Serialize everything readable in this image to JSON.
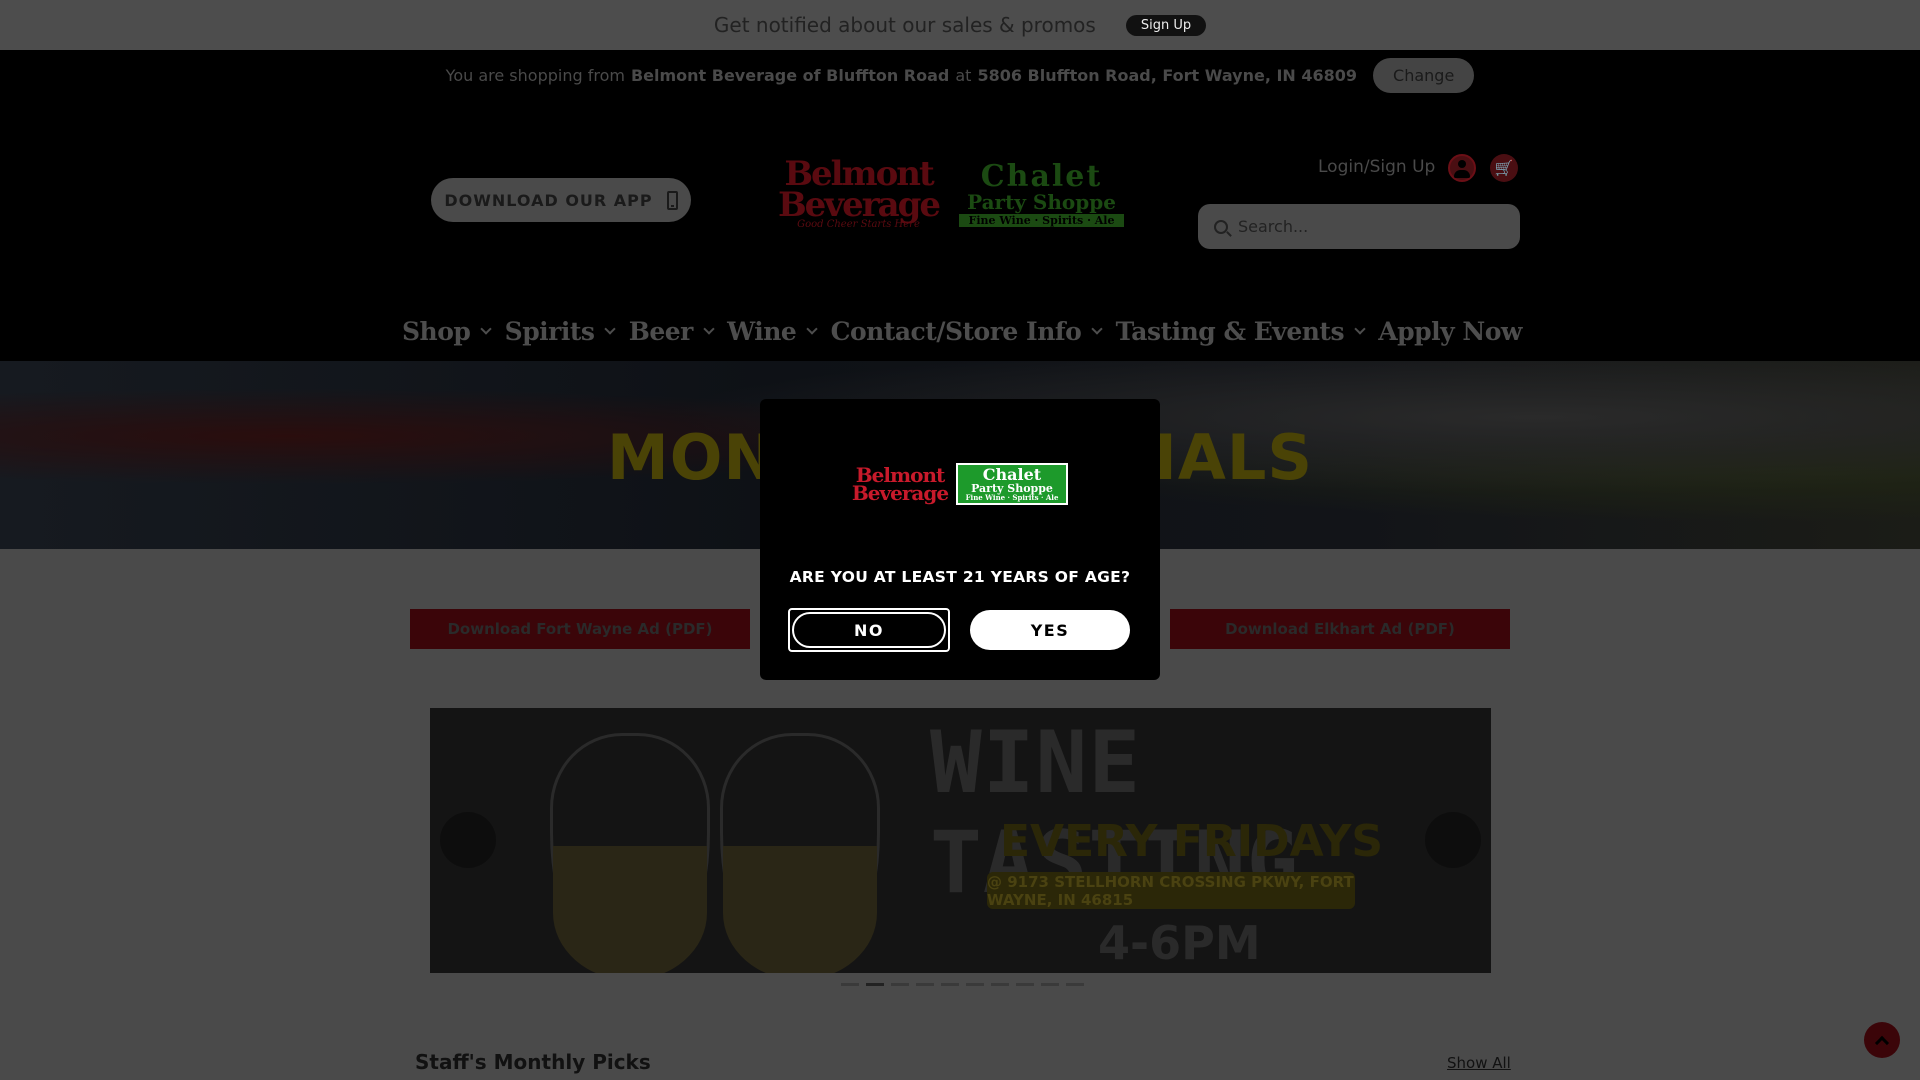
{
  "promo": {
    "text": "Get notified about our sales & promos",
    "button": "Sign Up"
  },
  "store": {
    "prefix": "You are shopping from",
    "name": "Belmont Beverage of Bluffton Road",
    "at": "at",
    "address": "5806 Bluffton Road, Fort Wayne, IN 46809",
    "change": "Change"
  },
  "header": {
    "app_button": "DOWNLOAD OUR APP",
    "logo": {
      "belmont_line1": "Belmont",
      "belmont_line2": "Beverage",
      "belmont_tag": "Good Cheer Starts Here",
      "chalet_line1": "Chalet",
      "chalet_line2": "Party Shoppe",
      "chalet_line3": "Fine Wine · Spirits · Ale"
    },
    "login": "Login/Sign Up",
    "search_placeholder": "Search..."
  },
  "nav": [
    {
      "label": "Shop",
      "dropdown": true
    },
    {
      "label": "Spirits",
      "dropdown": true
    },
    {
      "label": "Beer",
      "dropdown": true
    },
    {
      "label": "Wine",
      "dropdown": true
    },
    {
      "label": "Contact/Store Info",
      "dropdown": true
    },
    {
      "label": "Tasting & Events",
      "dropdown": true
    },
    {
      "label": "Apply Now",
      "dropdown": false
    }
  ],
  "hero": {
    "title": "MONTHLY SPECIALS"
  },
  "ads": {
    "fort_wayne": "Download Fort Wayne Ad (PDF)",
    "elkhart": "Download Elkhart Ad (PDF)"
  },
  "banner": {
    "title": "WINE TASTING",
    "subtitle": "EVERY FRIDAYS",
    "address": "@ 9173 STELLHORN CROSSING PKWY, FORT WAYNE, IN 46815",
    "time": "4-6PM",
    "slide_count": 10,
    "active_slide": 2
  },
  "staff": {
    "title": "Staff's Monthly Picks",
    "show_all": "Show All"
  },
  "modal": {
    "question": "ARE YOU AT LEAST 21 YEARS OF AGE?",
    "no": "NO",
    "yes": "YES"
  },
  "colors": {
    "brand_red": "#7a0a14",
    "brand_green": "#1d9a2b",
    "overlay": "rgba(0,0,0,0.7)"
  }
}
